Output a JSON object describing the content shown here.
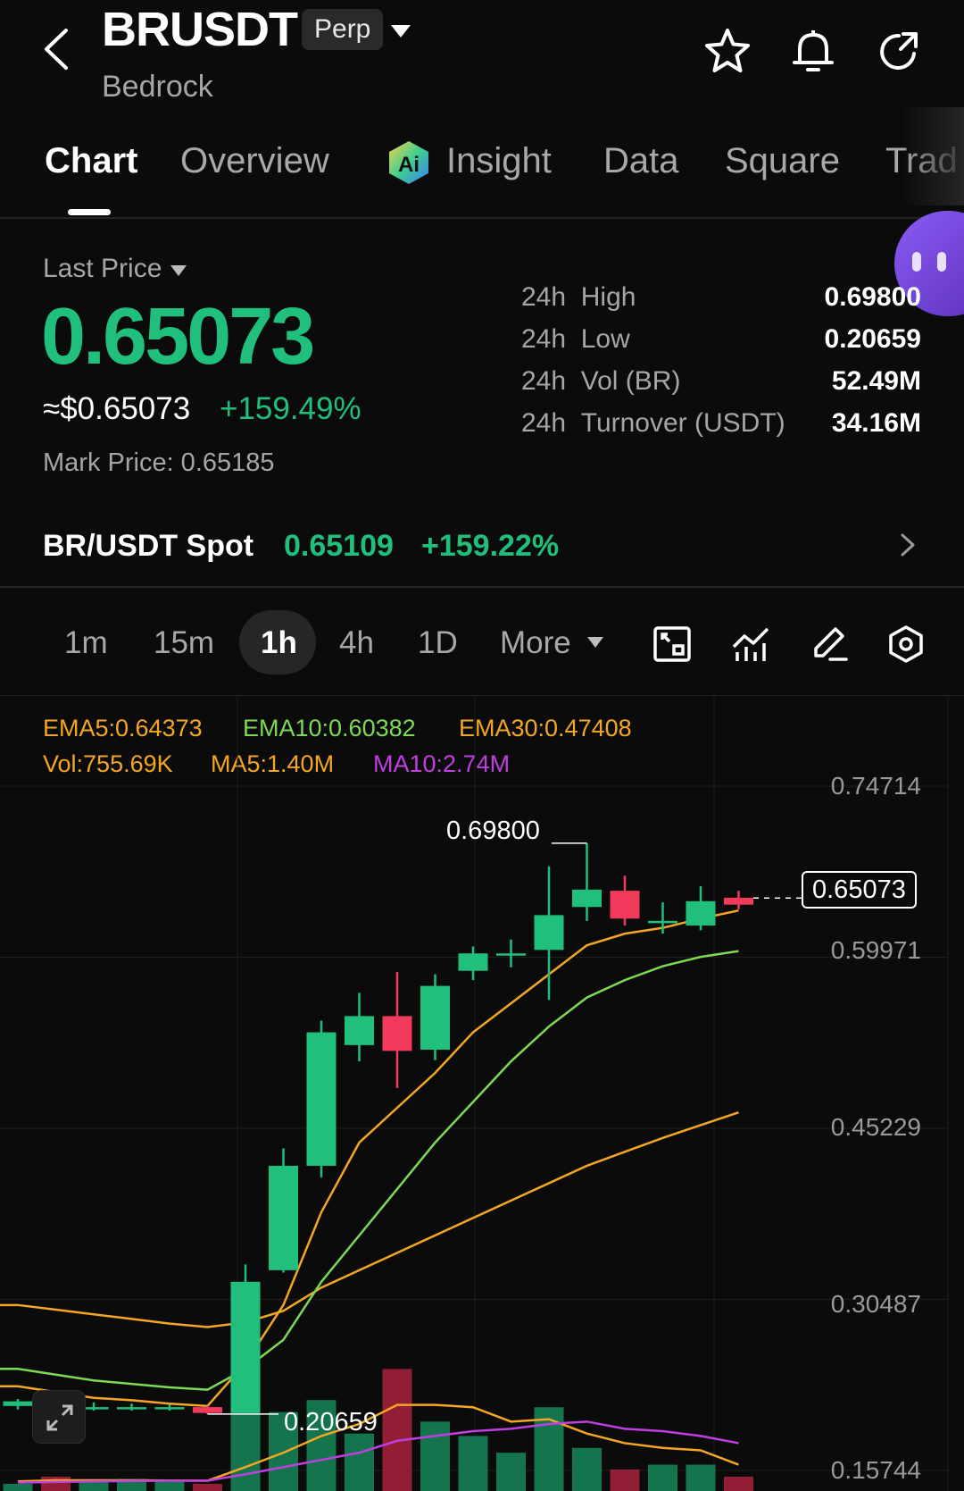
{
  "header": {
    "symbol": "BRUSDT",
    "contract_badge": "Perp",
    "subtitle": "Bedrock"
  },
  "tabs": [
    {
      "label": "Chart",
      "active": true
    },
    {
      "label": "Overview",
      "active": false
    },
    {
      "label": "Insight",
      "active": false
    },
    {
      "label": "Data",
      "active": false
    },
    {
      "label": "Square",
      "active": false
    },
    {
      "label": "Trad",
      "active": false
    }
  ],
  "price": {
    "last_price_label": "Last Price",
    "last_price": "0.65073",
    "usd_price": "≈$0.65073",
    "change_pct": "+159.49%",
    "mark_price": "Mark Price: 0.65185"
  },
  "stats": [
    {
      "prefix": "24h",
      "label": "High",
      "value": "0.69800"
    },
    {
      "prefix": "24h",
      "label": "Low",
      "value": "0.20659"
    },
    {
      "prefix": "24h",
      "label": "Vol (BR)",
      "value": "52.49M"
    },
    {
      "prefix": "24h",
      "label": "Turnover (USDT)",
      "value": "34.16M"
    }
  ],
  "spot": {
    "label": "BR/USDT Spot",
    "price": "0.65109",
    "change": "+159.22%"
  },
  "intervals": [
    "1m",
    "15m",
    "1h",
    "4h",
    "1D",
    "More"
  ],
  "active_interval": "1h",
  "indicators": {
    "ema5": "EMA5:0.64373",
    "ema10": "EMA10:0.60382",
    "ema30": "EMA30:0.47408",
    "vol": "Vol:755.69K",
    "ma5": "MA5:1.40M",
    "ma10": "MA10:2.74M"
  },
  "colors": {
    "up": "#20c07c",
    "down": "#f23a5c",
    "ema5": "#f5a623",
    "ema10": "#7ed957",
    "ema30": "#f5a623",
    "ma10": "#c03fe0"
  },
  "chart_data": {
    "type": "candlestick",
    "y_ticks": [
      "0.74714",
      "0.59971",
      "0.45229",
      "0.30487",
      "0.15744"
    ],
    "ylim": [
      0.15744,
      0.74714
    ],
    "high_label": "0.69800",
    "low_label": "0.20659",
    "current_price_label": "0.65073",
    "candles": [
      {
        "o": 0.213,
        "c": 0.217,
        "h": 0.219,
        "l": 0.21
      },
      {
        "o": 0.213,
        "c": 0.211,
        "h": 0.215,
        "l": 0.209
      },
      {
        "o": 0.211,
        "c": 0.212,
        "h": 0.216,
        "l": 0.209
      },
      {
        "o": 0.212,
        "c": 0.212,
        "h": 0.215,
        "l": 0.209
      },
      {
        "o": 0.212,
        "c": 0.212,
        "h": 0.214,
        "l": 0.209
      },
      {
        "o": 0.212,
        "c": 0.207,
        "h": 0.213,
        "l": 0.206
      },
      {
        "o": 0.207,
        "c": 0.32,
        "h": 0.335,
        "l": 0.207
      },
      {
        "o": 0.33,
        "c": 0.42,
        "h": 0.435,
        "l": 0.328
      },
      {
        "o": 0.42,
        "c": 0.535,
        "h": 0.545,
        "l": 0.41
      },
      {
        "o": 0.524,
        "c": 0.549,
        "h": 0.569,
        "l": 0.51
      },
      {
        "o": 0.549,
        "c": 0.519,
        "h": 0.587,
        "l": 0.487
      },
      {
        "o": 0.52,
        "c": 0.575,
        "h": 0.585,
        "l": 0.511
      },
      {
        "o": 0.588,
        "c": 0.603,
        "h": 0.609,
        "l": 0.58
      },
      {
        "o": 0.603,
        "c": 0.603,
        "h": 0.615,
        "l": 0.591
      },
      {
        "o": 0.606,
        "c": 0.636,
        "h": 0.678,
        "l": 0.563
      },
      {
        "o": 0.643,
        "c": 0.658,
        "h": 0.698,
        "l": 0.631
      },
      {
        "o": 0.657,
        "c": 0.633,
        "h": 0.67,
        "l": 0.627
      },
      {
        "o": 0.631,
        "c": 0.631,
        "h": 0.647,
        "l": 0.62
      },
      {
        "o": 0.627,
        "c": 0.648,
        "h": 0.661,
        "l": 0.623
      },
      {
        "o": 0.651,
        "c": 0.645,
        "h": 0.657,
        "l": 0.641
      }
    ],
    "ema5": [
      0.23,
      0.225,
      0.22,
      0.218,
      0.215,
      0.213,
      0.25,
      0.3,
      0.38,
      0.44,
      0.47,
      0.5,
      0.535,
      0.56,
      0.585,
      0.61,
      0.62,
      0.625,
      0.633,
      0.64
    ],
    "ema10": [
      0.245,
      0.24,
      0.235,
      0.232,
      0.229,
      0.227,
      0.245,
      0.27,
      0.32,
      0.36,
      0.4,
      0.44,
      0.475,
      0.51,
      0.54,
      0.565,
      0.58,
      0.592,
      0.6,
      0.605
    ],
    "ema30": [
      0.3,
      0.296,
      0.292,
      0.288,
      0.284,
      0.281,
      0.285,
      0.295,
      0.315,
      0.33,
      0.345,
      0.36,
      0.375,
      0.39,
      0.405,
      0.42,
      0.432,
      0.444,
      0.455,
      0.466
    ],
    "volume": [
      0.3,
      0.6,
      0.4,
      0.5,
      0.4,
      0.3,
      3.5,
      3.3,
      3.8,
      2.4,
      5.1,
      2.9,
      2.3,
      1.6,
      3.5,
      1.8,
      0.9,
      1.1,
      1.1,
      0.6
    ],
    "vol_ma5": [
      0.4,
      0.45,
      0.45,
      0.45,
      0.44,
      0.43,
      1.0,
      1.6,
      2.3,
      2.8,
      3.6,
      3.6,
      3.5,
      2.9,
      3.0,
      2.4,
      2.0,
      1.8,
      1.7,
      1.1
    ],
    "vol_ma10": [
      0.35,
      0.38,
      0.4,
      0.42,
      0.43,
      0.43,
      0.7,
      1.0,
      1.3,
      1.6,
      2.1,
      2.3,
      2.5,
      2.6,
      2.8,
      2.9,
      2.6,
      2.5,
      2.3,
      2.0
    ]
  }
}
